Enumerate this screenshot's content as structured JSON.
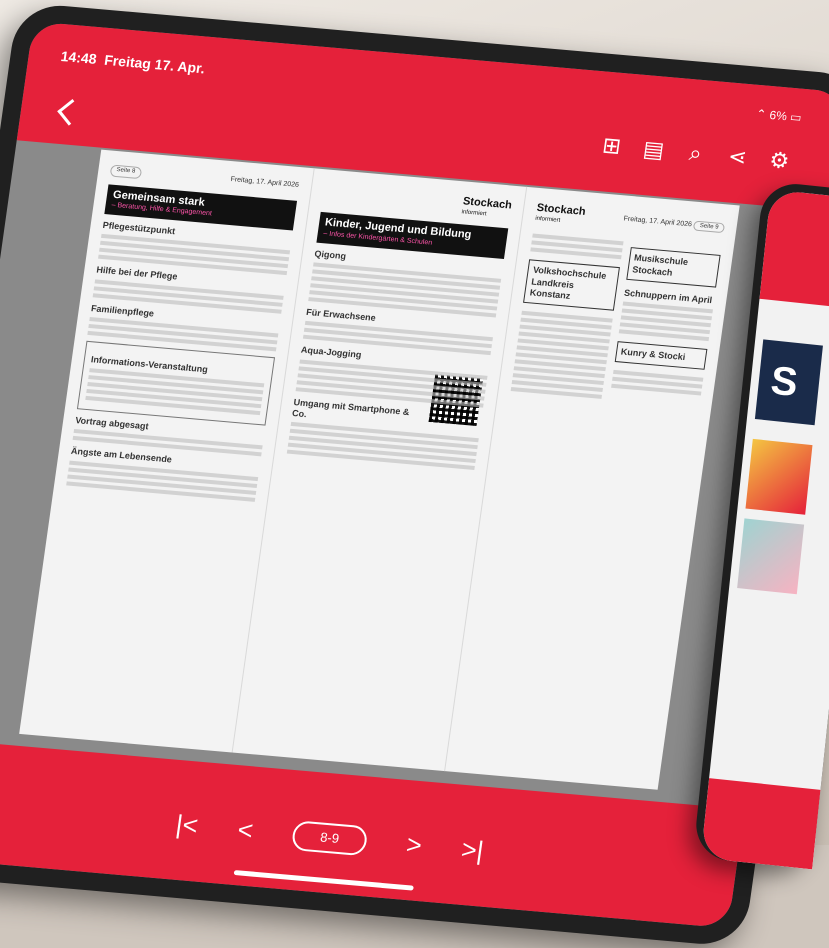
{
  "status": {
    "time": "14:48",
    "date": "Freitag 17. Apr.",
    "battery": "6%"
  },
  "toolbar": {
    "icons": [
      "grid-icon",
      "document-icon",
      "search-icon",
      "share-icon",
      "gear-icon"
    ]
  },
  "left_page": {
    "page_label": "Seite 8",
    "date_label": "Freitag, 17. April 2026",
    "logo_main": "Stockach",
    "logo_sub": "informiert",
    "section_title": "Gemeinsam stark",
    "section_sub": "– Beratung, Hilfe & Engagement",
    "h1": "Pflegestützpunkt",
    "h2": "Hilfe bei der Pflege",
    "h3": "Familienpflege",
    "box_title": "Informations-Veranstaltung",
    "h4": "Vortrag abgesagt",
    "h5": "Ängste am Lebensende"
  },
  "middle_page": {
    "section_title": "Kinder, Jugend und Bildung",
    "section_sub": "– Infos der Kindergärten & Schulen",
    "h1": "Qigong",
    "h2": "Für Erwachsene",
    "h3": "Aqua-Jogging",
    "h4": "Umgang mit Smartphone & Co."
  },
  "right_page": {
    "logo_main": "Stockach",
    "logo_sub": "informiert",
    "date_label": "Freitag, 17. April 2026",
    "page_label": "Seite 9",
    "section_title": "Volkshochschule Landkreis Konstanz",
    "music_title": "Musikschule Stockach",
    "music_sub": "Schnuppern im April",
    "kunry": "Kunry & Stocki"
  },
  "nav": {
    "page_indicator": "8-9"
  }
}
